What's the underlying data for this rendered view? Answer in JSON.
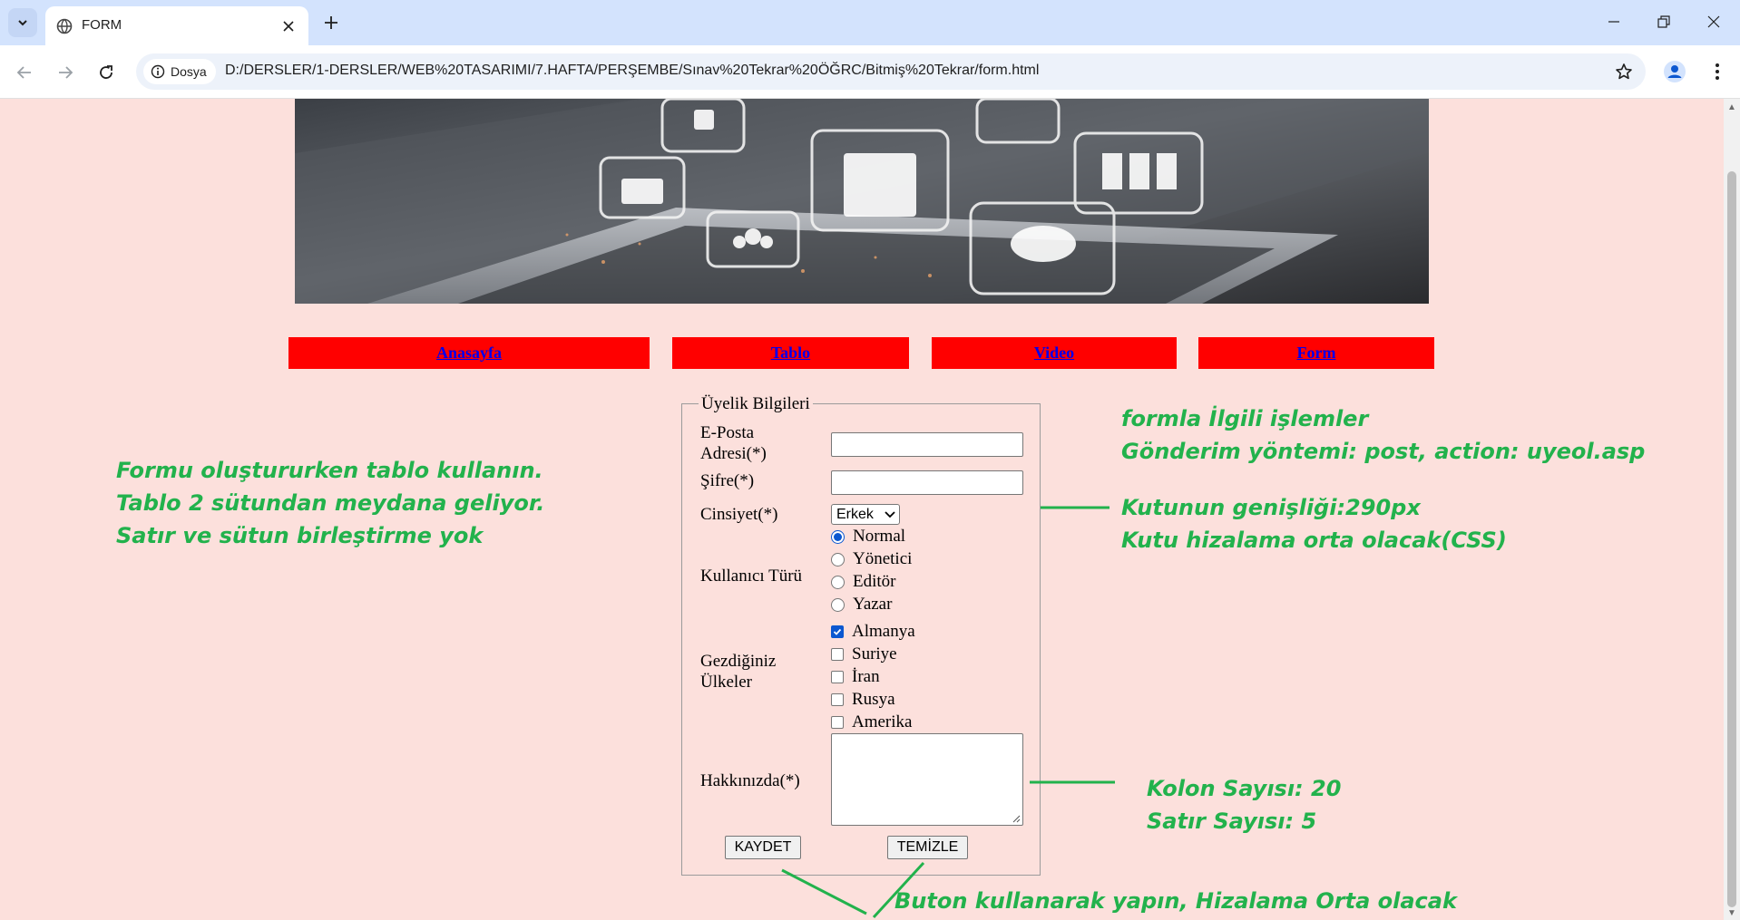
{
  "browser": {
    "tab_title": "FORM",
    "site_chip_label": "Dosya",
    "url": "D:/DERSLER/1-DERSLER/WEB%20TASARIMI/7.HAFTA/PERŞEMBE/Sınav%20Tekrar%20ÖĞRC/Bitmiş%20Tekrar/form.html"
  },
  "nav": {
    "links": [
      {
        "label": "Anasayfa"
      },
      {
        "label": "Tablo"
      },
      {
        "label": "Video"
      },
      {
        "label": "Form"
      }
    ],
    "background": "#ff0000",
    "link_color": "#0000ee"
  },
  "form": {
    "legend": "Üyelik Bilgileri",
    "email_label": "E-Posta Adresi(*)",
    "email_value": "",
    "password_label": "Şifre(*)",
    "password_value": "",
    "gender_label": "Cinsiyet(*)",
    "gender_selected": "Erkek",
    "user_type_label": "Kullanıcı Türü",
    "user_types": [
      {
        "label": "Normal",
        "checked": true
      },
      {
        "label": "Yönetici",
        "checked": false
      },
      {
        "label": "Editör",
        "checked": false
      },
      {
        "label": "Yazar",
        "checked": false
      }
    ],
    "countries_label": "Gezdiğiniz Ülkeler",
    "countries": [
      {
        "label": "Almanya",
        "checked": true
      },
      {
        "label": "Suriye",
        "checked": false
      },
      {
        "label": "İran",
        "checked": false
      },
      {
        "label": "Rusya",
        "checked": false
      },
      {
        "label": "Amerika",
        "checked": false
      }
    ],
    "about_label": "Hakkınızda(*)",
    "about_value": "",
    "save_button": "KAYDET",
    "clear_button": "TEMİZLE"
  },
  "notes": {
    "left": [
      "Formu oluştururken tablo kullanın.",
      "Tablo 2 sütundan meydana geliyor.",
      "Satır ve sütun birleştirme yok"
    ],
    "top_right": [
      "formla İlgili işlemler",
      "Gönderim yöntemi: post, action: uyeol.asp"
    ],
    "middle_right": [
      "Kutunun genişliği:290px",
      "Kutu hizalama orta olacak(CSS)"
    ],
    "bottom_right": [
      "Kolon Sayısı: 20",
      "Satır Sayısı: 5"
    ],
    "bottom": "Buton kullanarak yapın, Hizalama Orta olacak",
    "color": "#22b24c"
  },
  "colors": {
    "page_background": "#fce0dc",
    "tabstrip": "#d3e3fd"
  },
  "icons": [
    "tab-search-icon",
    "globe-icon",
    "close-icon",
    "plus-icon",
    "minimize-icon",
    "restore-icon",
    "window-close-icon",
    "back-arrow-icon",
    "forward-arrow-icon",
    "reload-icon",
    "info-icon",
    "star-icon",
    "profile-icon",
    "kebab-menu-icon"
  ]
}
